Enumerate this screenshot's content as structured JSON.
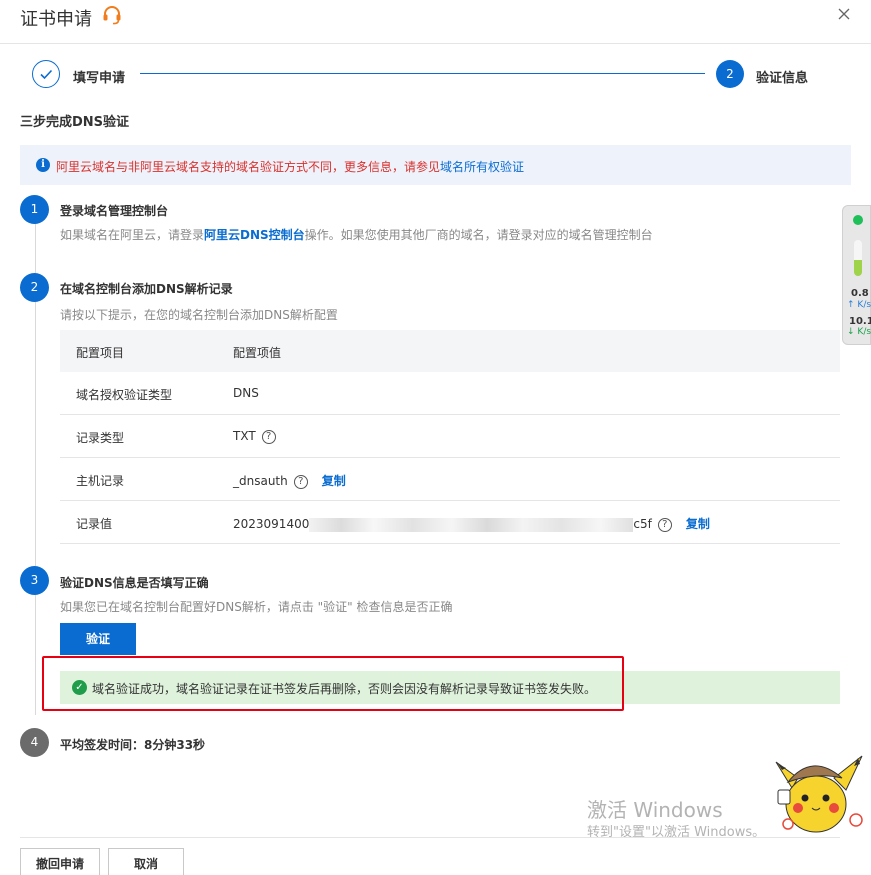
{
  "header": {
    "title": "证书申请",
    "support_icon": "headset-icon",
    "close_icon": "close-icon"
  },
  "stepper": {
    "step1_label": "填写申请",
    "step2_number": "2",
    "step2_label": "验证信息"
  },
  "section_title": "三步完成DNS验证",
  "notice": {
    "text": "阿里云域名与非阿里云域名支持的域名验证方式不同，更多信息，请参见",
    "link": "域名所有权验证"
  },
  "steps": [
    {
      "number": "1",
      "title": "登录域名管理控制台",
      "desc_prefix": "如果域名在阿里云，请登录",
      "desc_link": "阿里云DNS控制台",
      "desc_suffix": "操作。如果您使用其他厂商的域名，请登录对应的域名管理控制台"
    },
    {
      "number": "2",
      "title": "在域名控制台添加DNS解析记录",
      "desc": "请按以下提示，在您的域名控制台添加DNS解析配置"
    },
    {
      "number": "3",
      "title": "验证DNS信息是否填写正确",
      "desc": "如果您已在域名控制台配置好DNS解析，请点击 \"验证\" 检查信息是否正确"
    },
    {
      "number": "4",
      "title": "平均签发时间：8分钟33秒"
    }
  ],
  "dns_table": {
    "headers": [
      "配置项目",
      "配置项值"
    ],
    "rows": [
      {
        "item": "域名授权验证类型",
        "value": "DNS"
      },
      {
        "item": "记录类型",
        "value": "TXT"
      },
      {
        "item": "主机记录",
        "value": "_dnsauth",
        "copy": "复制"
      },
      {
        "item": "记录值",
        "value_start": "2023091400",
        "value_end": "c5f",
        "copy": "复制"
      }
    ]
  },
  "verify_button": "验证",
  "success_message": "域名验证成功，域名验证记录在证书签发后再删除，否则会因没有解析记录导致证书签发失败。",
  "network_widget": {
    "upload_value": "0.8",
    "upload_unit": "K/s",
    "download_value": "10.1",
    "download_unit": "K/s"
  },
  "watermark": {
    "line1": "激活 Windows",
    "line2": "转到\"设置\"以激活 Windows。"
  },
  "footer": {
    "withdraw_button": "撤回申请",
    "cancel_button": "取消"
  },
  "colors": {
    "primary": "#0a6cd1",
    "notice_bg": "#eef3fb",
    "notice_text": "#d9302c",
    "success_bg": "#dff3dc",
    "success_icon": "#1f9d4a",
    "highlight_border": "#e60012"
  }
}
